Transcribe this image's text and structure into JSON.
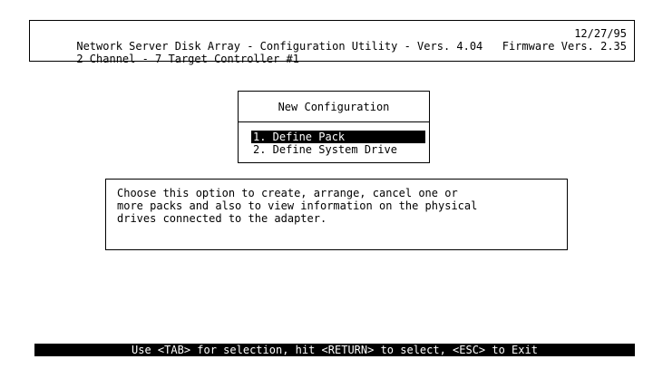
{
  "header": {
    "line1_left": "Network Server Disk Array - Configuration Utility - Vers. 4.04",
    "line1_right": "12/27/95",
    "line2_left": "2 Channel - 7 Target Controller #1",
    "line2_right": "Firmware Vers. 2.35"
  },
  "menu": {
    "title": "New Configuration",
    "items": [
      {
        "label": "1. Define Pack",
        "selected": true
      },
      {
        "label": "2. Define System Drive",
        "selected": false
      }
    ]
  },
  "help": {
    "lines": [
      "Choose this option to create, arrange, cancel one or",
      "more packs and also to view information on the physical",
      "drives connected to the adapter."
    ]
  },
  "status_bar": {
    "text": "Use <TAB> for selection, hit <RETURN> to select, <ESC> to Exit"
  },
  "colors": {
    "background": "#ffffff",
    "foreground": "#000000",
    "highlight_bg": "#000000",
    "highlight_fg": "#ffffff"
  }
}
